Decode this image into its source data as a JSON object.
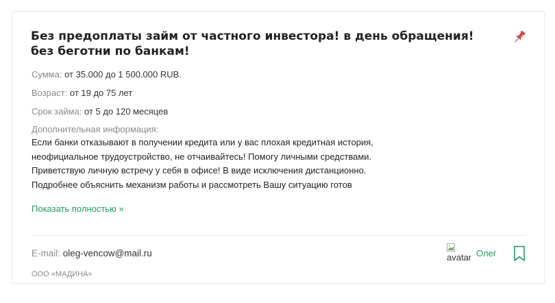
{
  "listing": {
    "title": "Без предоплаты займ от частного инвестора! в день обращения! без беготни по банкам!",
    "icons": {
      "pin": "pushpin-icon",
      "bookmark": "bookmark-icon",
      "avatar_broken": "broken-image-icon"
    },
    "fields": [
      {
        "label": "Сумма:",
        "value": "от 35.000 до 1 500.000 RUB."
      },
      {
        "label": "Возраст:",
        "value": "от 19 до 75 лет"
      },
      {
        "label": "Срок займа:",
        "value": "от 5 до 120 месяцев"
      }
    ],
    "info_label": "Дополнительная информация:",
    "info_lines": [
      "Если банки отказывают в получении кредита или у вас плохая кредитная история,",
      "неофициальное трудоустройство, не отчаивайтесь! Помогу личными средствами.",
      "Приветствую личную встречу у себя в офисе! В виде исключения дистанционно.",
      "Подробнее объяснить механизм работы и рассмотреть Вашу ситуацию готов"
    ],
    "show_more": "Показать полностью »",
    "email_label": "E-mail:",
    "email": "oleg-vencow@mail.ru",
    "company": "ООО «МАДИНА»",
    "avatar_alt": "avatar",
    "author": "Олег",
    "colors": {
      "accent": "#1d9a5c",
      "pin": "#d93b3b",
      "muted": "#8a8a8a"
    }
  }
}
